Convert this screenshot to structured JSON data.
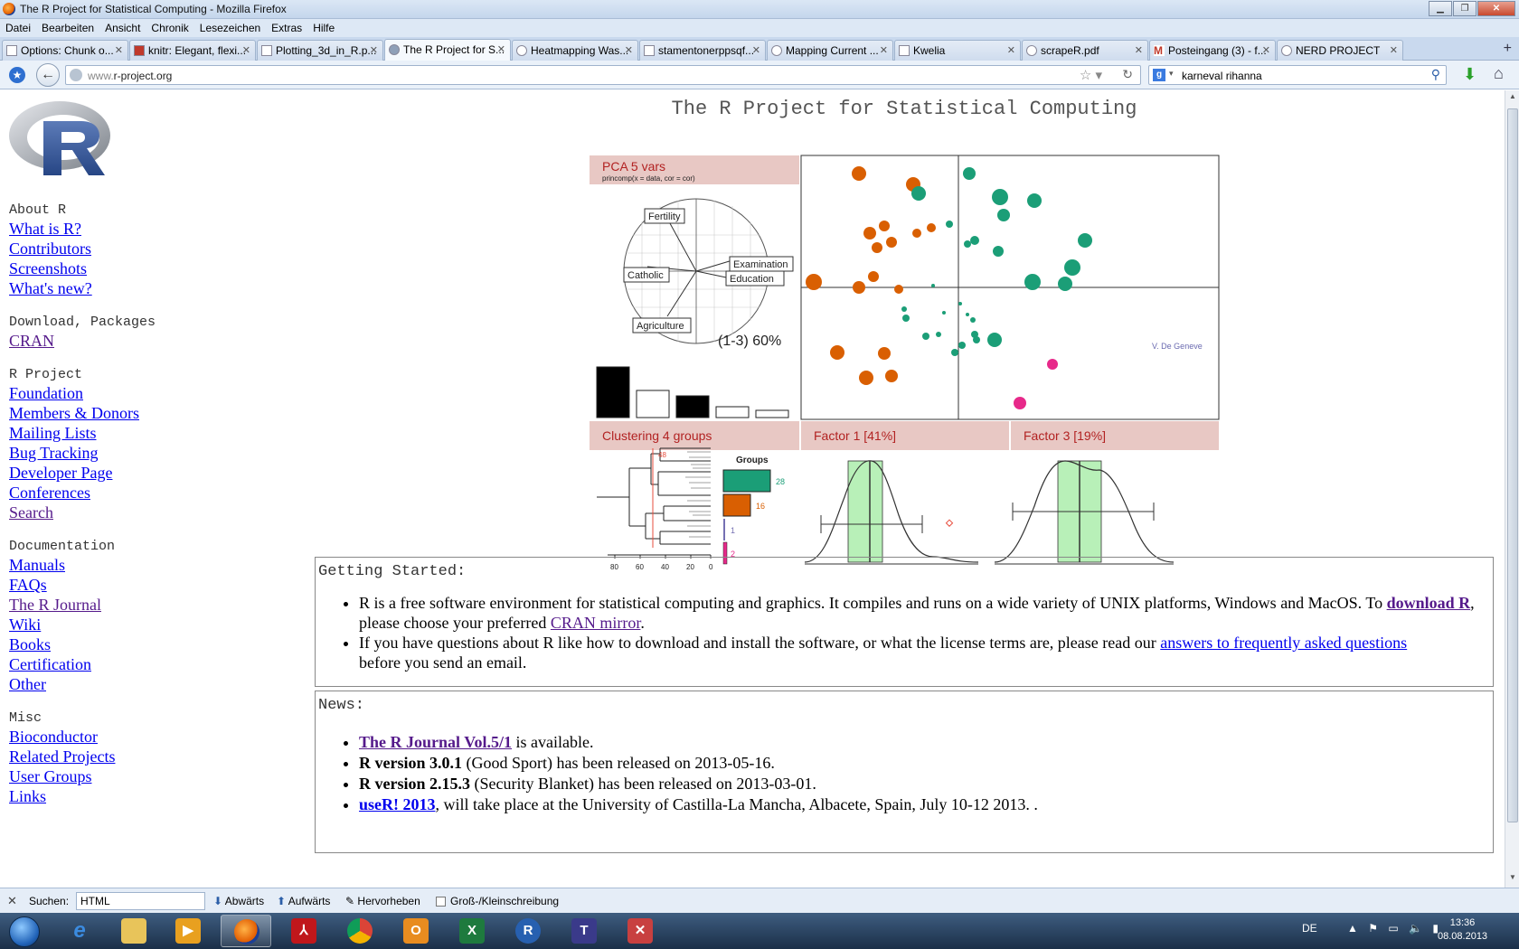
{
  "window": {
    "title": "The R Project for Statistical Computing - Mozilla Firefox"
  },
  "menu": [
    "Datei",
    "Bearbeiten",
    "Ansicht",
    "Chronik",
    "Lesezeichen",
    "Extras",
    "Hilfe"
  ],
  "tabs": [
    {
      "label": "Options: Chunk o..."
    },
    {
      "label": "knitr: Elegant, flexi..."
    },
    {
      "label": "Plotting_3d_in_R.p..."
    },
    {
      "label": "The R Project for S..."
    },
    {
      "label": "Heatmapping Was..."
    },
    {
      "label": "stamentonerppsqf..."
    },
    {
      "label": "Mapping Current ..."
    },
    {
      "label": "Kwelia"
    },
    {
      "label": "scrapeR.pdf"
    },
    {
      "label": "Posteingang (3) - f..."
    },
    {
      "label": "NERD PROJECT"
    }
  ],
  "nav": {
    "url_prefix": "www.",
    "url_domain": "r-project.org",
    "search_value": "karneval rihanna"
  },
  "page": {
    "title": "The R Project for Statistical Computing",
    "sidebar": [
      {
        "heading": "About R",
        "links": [
          "What is R?",
          "Contributors",
          "Screenshots",
          "What's new?"
        ]
      },
      {
        "heading": "Download, Packages",
        "links": [
          "CRAN"
        ]
      },
      {
        "heading": "R Project",
        "links": [
          "Foundation",
          "Members & Donors",
          "Mailing Lists",
          "Bug Tracking",
          "Developer Page",
          "Conferences",
          "Search"
        ]
      },
      {
        "heading": "Documentation",
        "links": [
          "Manuals",
          "FAQs",
          "The R Journal",
          "Wiki",
          "Books",
          "Certification",
          "Other"
        ]
      },
      {
        "heading": "Misc",
        "links": [
          "Bioconductor",
          "Related Projects",
          "User Groups",
          "Links"
        ]
      }
    ],
    "figure": {
      "pca_title": "PCA  5 vars",
      "pca_sub": "princomp(x = data, cor = cor)",
      "vars": [
        "Fertility",
        "Examination",
        "Catholic",
        "Education",
        "Agriculture"
      ],
      "pct": "(1-3) 60%",
      "clustering": "Clustering  4 groups",
      "factor1": "Factor 1 [41%]",
      "factor3": "Factor 3 [19%]",
      "groups_title": "Groups",
      "group_counts": [
        "28",
        "16",
        "1",
        "2"
      ],
      "dendro_ticks": [
        "80",
        "60",
        "40",
        "20",
        "0"
      ],
      "credit": "V. De Geneve",
      "cut": "48",
      "colors": {
        "green": "#1b9e77",
        "orange": "#d95f02",
        "pink": "#e7298a",
        "blue": "#7570b3",
        "band": "#e8c8c4"
      }
    },
    "getting_started": {
      "heading": "Getting Started:",
      "p1_a": "R is a free software environment for statistical computing and graphics. It compiles and runs on a wide variety of UNIX platforms, Windows and MacOS. To ",
      "p1_link1": "download R",
      "p1_b": ", please choose your preferred ",
      "p1_link2": "CRAN mirror",
      "p1_c": ".",
      "p2_a": "If you have questions about R like how to download and install the software, or what the license terms are, please read our ",
      "p2_link": "answers to frequently asked questions",
      "p2_b": "before you send an email."
    },
    "news": {
      "heading": "News:",
      "items": [
        {
          "bold": "The R Journal Vol.5/1",
          "rest": " is available."
        },
        {
          "bold": "R version 3.0.1",
          "rest": " (Good Sport) has been released on 2013-05-16."
        },
        {
          "bold": "R version 2.15.3",
          "rest": " (Security Blanket) has been released on 2013-03-01."
        },
        {
          "bold": "useR! 2013",
          "rest": ", will take place at the University of Castilla-La Mancha, Albacete, Spain, July 10-12 2013. ."
        }
      ]
    }
  },
  "findbar": {
    "label": "Suchen:",
    "value": "HTML",
    "down": "Abwärts",
    "up": "Aufwärts",
    "highlight": "Hervorheben",
    "case": "Groß-/Kleinschreibung"
  },
  "taskbar": {
    "lang": "DE",
    "time": "13:36",
    "date": "08.08.2013"
  }
}
